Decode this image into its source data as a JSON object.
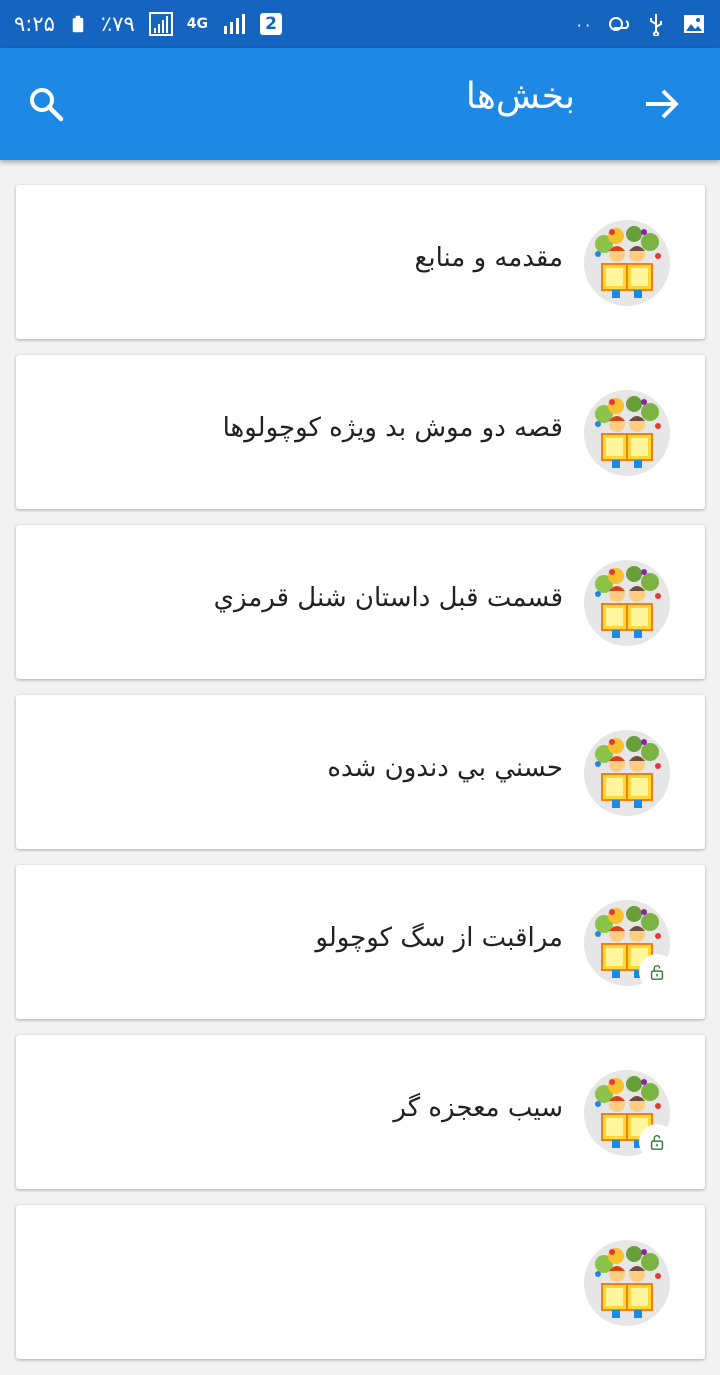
{
  "status_bar": {
    "time": "۹:۲۵",
    "battery": "٪۷۹",
    "network": "4G",
    "sim_badge": "2",
    "data_dots": "۰۰"
  },
  "app_bar": {
    "title": "بخش‌ها",
    "back_icon": "arrow-forward-icon",
    "search_icon": "search-icon"
  },
  "colors": {
    "status_bar": "#1565c0",
    "app_bar": "#1e88e5",
    "lock_icon": "#2e7d32"
  },
  "items": [
    {
      "title": "مقدمه و منابع",
      "locked": false
    },
    {
      "title": "قصه دو موش بد ويژه کوچولوها",
      "locked": false
    },
    {
      "title": "قسمت قبل داستان شنل قرمزي",
      "locked": false
    },
    {
      "title": "حسني بي دندون شده",
      "locked": false
    },
    {
      "title": "مراقبت از سگ کوچولو",
      "locked": true
    },
    {
      "title": "سیب معجزه گر",
      "locked": true
    },
    {
      "title": "",
      "locked": false
    }
  ]
}
